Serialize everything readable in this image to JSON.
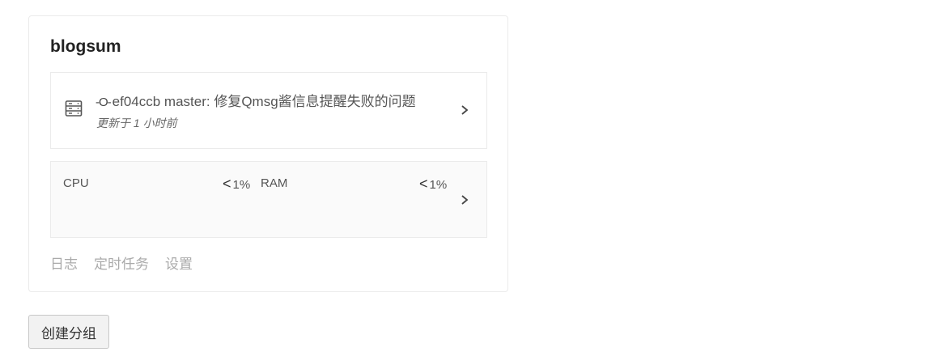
{
  "app": {
    "name": "blogsum",
    "deploy": {
      "commit_glyph": "-O-",
      "commit_text": "ef04ccb master: 修复Qmsg酱信息提醒失败的问题",
      "updated": "更新于 1 小时前",
      "icon": "server-icon"
    },
    "metrics": {
      "cpu_label": "CPU",
      "cpu_prefix": "<",
      "cpu_value": "1%",
      "ram_label": "RAM",
      "ram_prefix": "<",
      "ram_value": "1%"
    },
    "links": [
      "日志",
      "定时任务",
      "设置"
    ]
  },
  "actions": {
    "create_group_label": "创建分组"
  },
  "colors": {
    "border": "#ebebeb",
    "link_muted": "#aaaaaa",
    "metrics_bg": "#fafafa",
    "button_bg": "#f2f2f2"
  }
}
